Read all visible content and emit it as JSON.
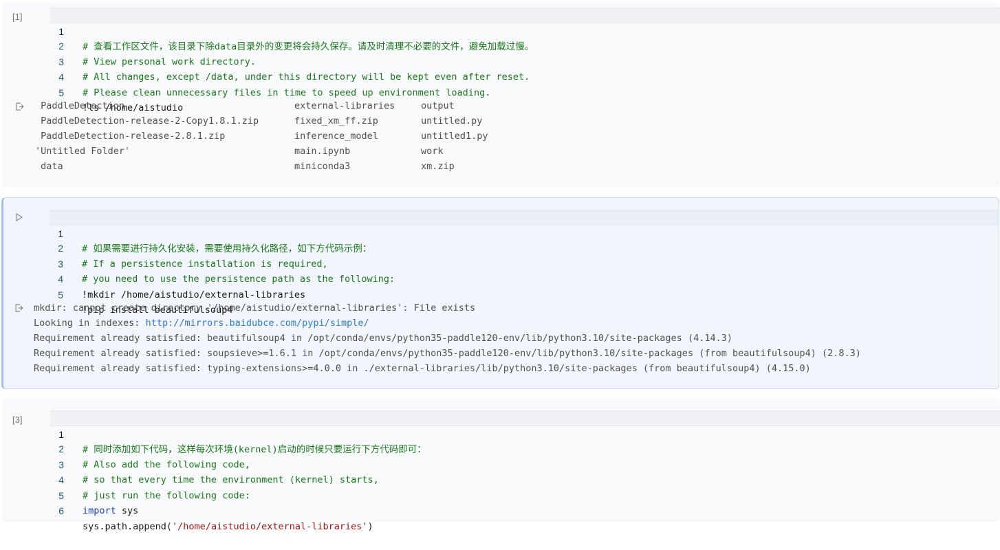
{
  "cells": [
    {
      "prompt": "[1]",
      "lines": [
        {
          "n": "1",
          "text": "# 查看工作区文件，该目录下除data目录外的变更将会持久保存。请及时清理不必要的文件，避免加载过慢。"
        },
        {
          "n": "2",
          "text": "# View personal work directory."
        },
        {
          "n": "3",
          "text": "# All changes, except /data, under this directory will be kept even after reset."
        },
        {
          "n": "4",
          "text": "# Please clean unnecessary files in time to speed up environment loading."
        },
        {
          "n": "5",
          "text": "!ls /home/aistudio"
        }
      ],
      "output": {
        "col1": [
          " PaddleDetection",
          " PaddleDetection-release-2-Copy1.8.1.zip",
          " PaddleDetection-release-2.8.1.zip",
          "'Untitled Folder'",
          " data"
        ],
        "col2": [
          "external-libraries",
          "fixed_xm_ff.zip",
          "inference_model",
          "main.ipynb",
          "miniconda3"
        ],
        "col3": [
          "output",
          "untitled.py",
          "untitled1.py",
          "work",
          "xm.zip"
        ]
      }
    },
    {
      "prompt": "",
      "lines": [
        {
          "n": "1",
          "text": "# 如果需要进行持久化安装，需要使用持久化路径，如下方代码示例："
        },
        {
          "n": "2",
          "text": "# If a persistence installation is required,"
        },
        {
          "n": "3",
          "text": "# you need to use the persistence path as the following:"
        },
        {
          "n": "4",
          "text": "!mkdir /home/aistudio/external-libraries"
        },
        {
          "n": "5",
          "text": "!pip install beautifulsoup4"
        }
      ],
      "output": {
        "line1": "mkdir: cannot create directory '/home/aistudio/external-libraries': File exists",
        "line2_prefix": "Looking in indexes: ",
        "line2_link": "http://mirrors.baidubce.com/pypi/simple/",
        "line3": "Requirement already satisfied: beautifulsoup4 in /opt/conda/envs/python35-paddle120-env/lib/python3.10/site-packages (4.14.3)",
        "line4": "Requirement already satisfied: soupsieve>=1.6.1 in /opt/conda/envs/python35-paddle120-env/lib/python3.10/site-packages (from beautifulsoup4) (2.8.3)",
        "line5": "Requirement already satisfied: typing-extensions>=4.0.0 in ./external-libraries/lib/python3.10/site-packages (from beautifulsoup4) (4.15.0)"
      }
    },
    {
      "prompt": "[3]",
      "lines": [
        {
          "n": "1",
          "text": "# 同时添加如下代码，这样每次环境(kernel)启动的时候只要运行下方代码即可："
        },
        {
          "n": "2",
          "text": "# Also add the following code,"
        },
        {
          "n": "3",
          "text": "# so that every time the environment (kernel) starts,"
        },
        {
          "n": "4",
          "text": "# just run the following code:"
        },
        {
          "n": "5",
          "kw": "import",
          "rest": " sys"
        },
        {
          "n": "6",
          "pre": "sys.path.append(",
          "str": "'/home/aistudio/external-libraries'",
          "post": ")"
        }
      ]
    }
  ],
  "icons": {
    "run": "play-icon",
    "output": "output-arrow-icon"
  },
  "colors": {
    "comment": "#1a7a1a",
    "keyword": "#1e43c8",
    "string": "#a31515",
    "link": "#2a7ad8",
    "activeBorder": "#9ec1ef"
  }
}
